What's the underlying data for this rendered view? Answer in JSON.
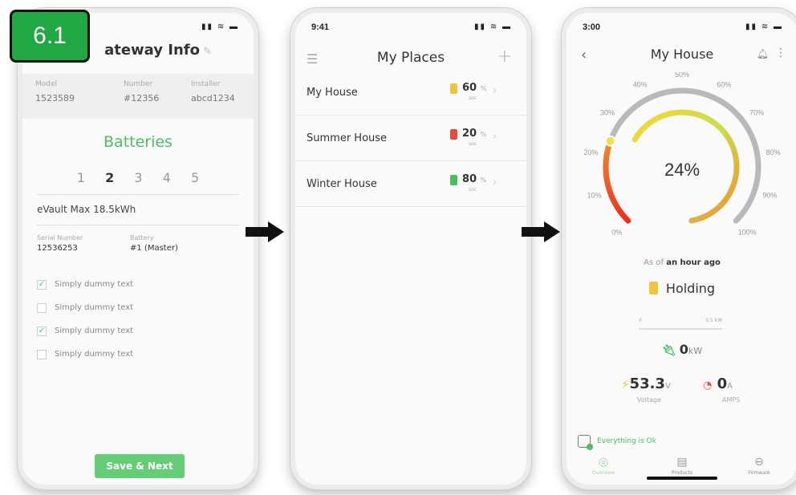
{
  "badge": "6.1",
  "screen1": {
    "title": "ateway Info",
    "info": [
      {
        "label": "Model",
        "value": "1523589"
      },
      {
        "label": "Number",
        "value": "#12356"
      },
      {
        "label": "Installer",
        "value": "abcd1234"
      }
    ],
    "section_title": "Batteries",
    "pages": [
      "1",
      "2",
      "3",
      "4",
      "5"
    ],
    "active_page": "2",
    "device_name": "eVault Max 18.5kWh",
    "serial_label": "Serial Number",
    "serial_value": "12536253",
    "battery_label": "Battery",
    "battery_value": "#1 (Master)",
    "checks": [
      {
        "label": "Simply dummy text",
        "checked": true
      },
      {
        "label": "Simply dummy text",
        "checked": false
      },
      {
        "label": "Simply dummy text",
        "checked": true
      },
      {
        "label": "Simply dummy text",
        "checked": false
      }
    ],
    "save_button": "Save & Next"
  },
  "screen2": {
    "time": "9:41",
    "title": "My Places",
    "places": [
      {
        "name": "My House",
        "percent": "60",
        "unit": "%",
        "soc": "soc",
        "battery_color": "#f2c43c"
      },
      {
        "name": "Summer House",
        "percent": "20",
        "unit": "%",
        "soc": "soc",
        "battery_color": "#e84a3c"
      },
      {
        "name": "Winter House",
        "percent": "80",
        "unit": "%",
        "soc": "soc",
        "battery_color": "#4dbd62"
      }
    ]
  },
  "screen3": {
    "time": "3:00",
    "title": "My House",
    "gauge_value": "24%",
    "gauge_labels": [
      "0%",
      "10%",
      "20%",
      "30%",
      "40%",
      "50%",
      "60%",
      "70%",
      "80%",
      "90%",
      "100%"
    ],
    "gauge_level": 0.24,
    "as_of_prefix": "As of",
    "as_of_value": "an hour ago",
    "status": "Holding",
    "scale_min": "0",
    "scale_max": "0.5 kW",
    "power_value": "0",
    "power_unit": "kW",
    "voltage_value": "53.3",
    "voltage_unit": "V",
    "voltage_label": "Voltage",
    "amps_value": "0",
    "amps_unit": "A",
    "amps_label": "AMPS",
    "ok_text": "Everything is Ok",
    "tabs": [
      "Overview",
      "Products",
      "Firmware"
    ]
  }
}
